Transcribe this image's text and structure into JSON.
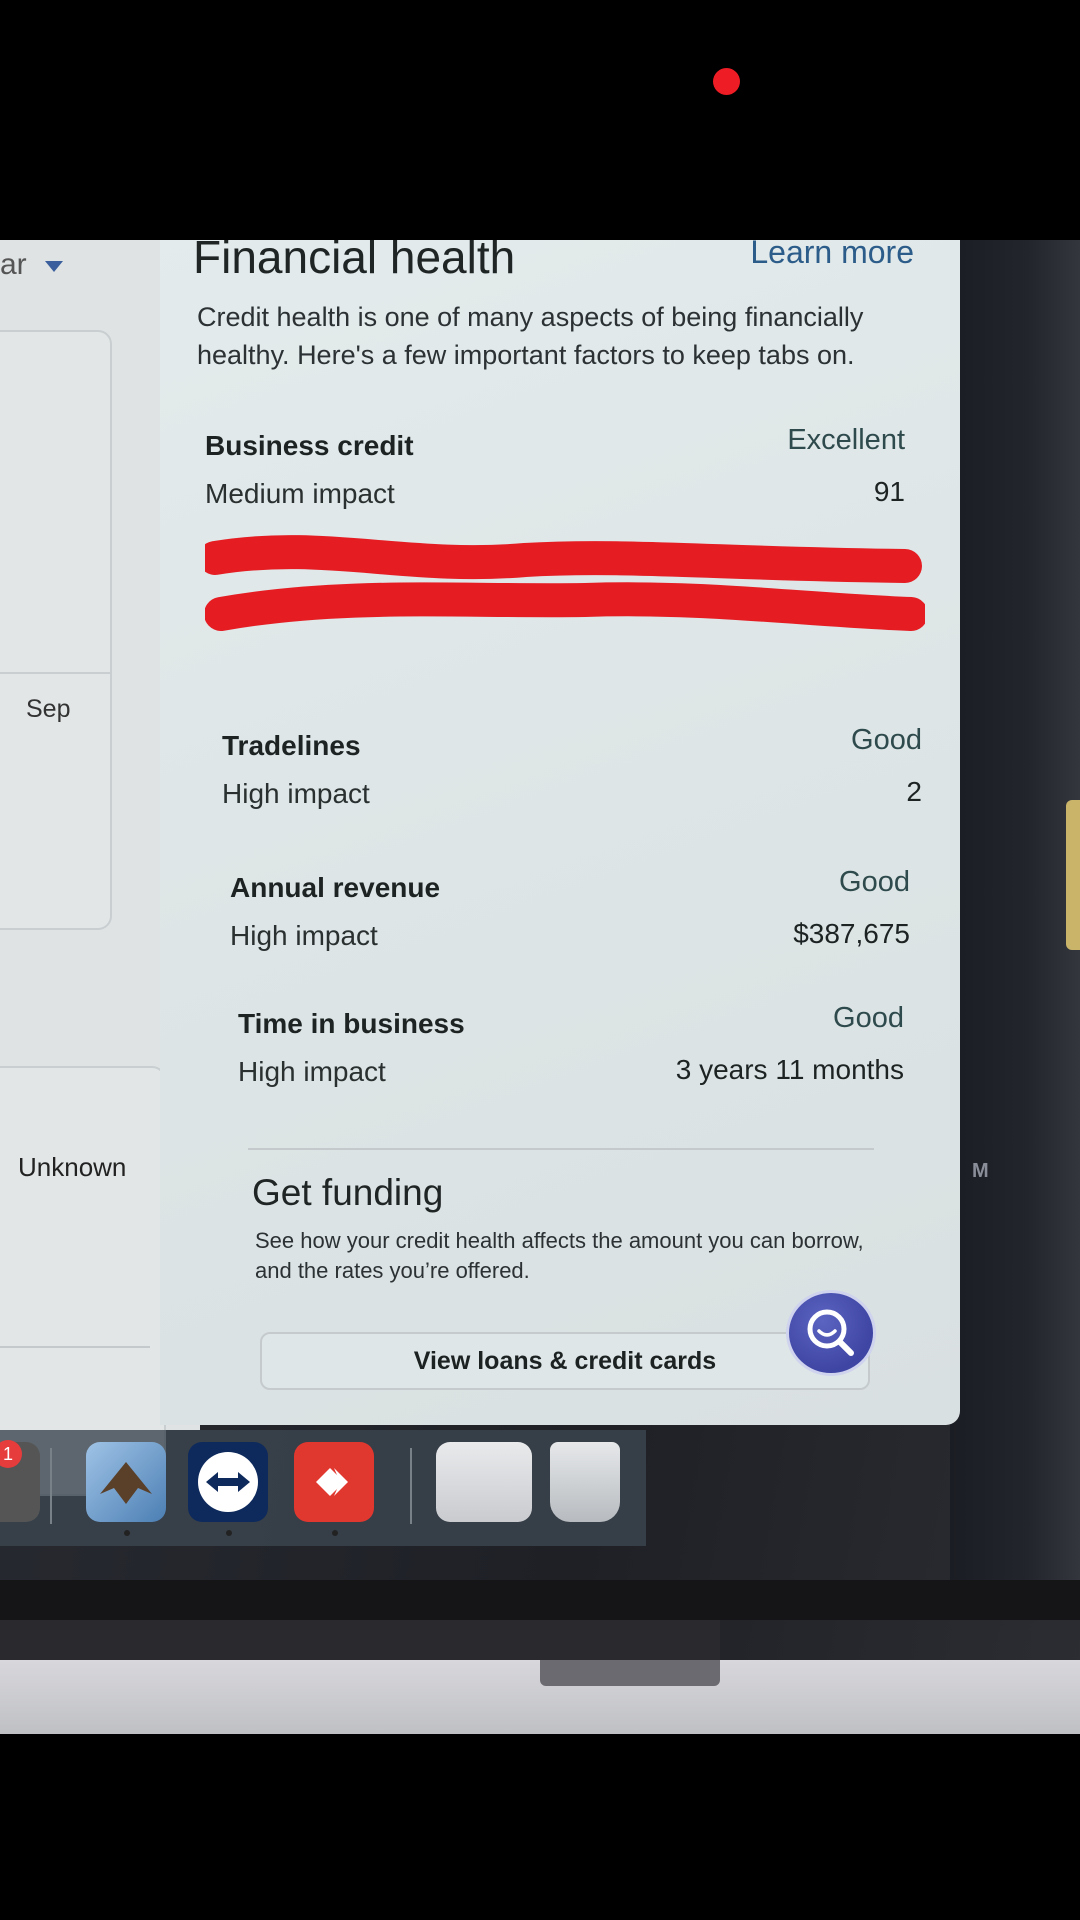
{
  "overlay": {
    "recording_indicator_color": "#ee1c24"
  },
  "left_column": {
    "dropdown_label": "ar",
    "month_label": "Sep",
    "status_label": "Unknown"
  },
  "panel": {
    "title": "Financial health",
    "learn_more": "Learn more",
    "description": "Credit health is one of many aspects of being financially healthy. Here's a few important factors to keep tabs on.",
    "factors": [
      {
        "name": "Business credit",
        "impact": "Medium impact",
        "rating": "Excellent",
        "value": "91"
      },
      {
        "name": "Tradelines",
        "impact": "High impact",
        "rating": "Good",
        "value": "2"
      },
      {
        "name": "Annual revenue",
        "impact": "High impact",
        "rating": "Good",
        "value": "$387,675"
      },
      {
        "name": "Time in business",
        "impact": "High impact",
        "rating": "Good",
        "value": "3 years 11 months"
      }
    ],
    "redaction_color": "#e51d23"
  },
  "funding": {
    "title": "Get funding",
    "description": "See how your credit health affects the amount you can borrow, and the rates you’re offered.",
    "button_label": "View loans & credit cards"
  },
  "chat": {
    "icon": "search-chat-icon",
    "color": "#3e45a3"
  },
  "dock": {
    "badge_count": "1",
    "apps": [
      "mail-app-icon",
      "teamviewer-icon",
      "anydesk-icon",
      "documents-stack-icon",
      "trash-icon"
    ]
  },
  "bezel": {
    "letter": "M"
  }
}
